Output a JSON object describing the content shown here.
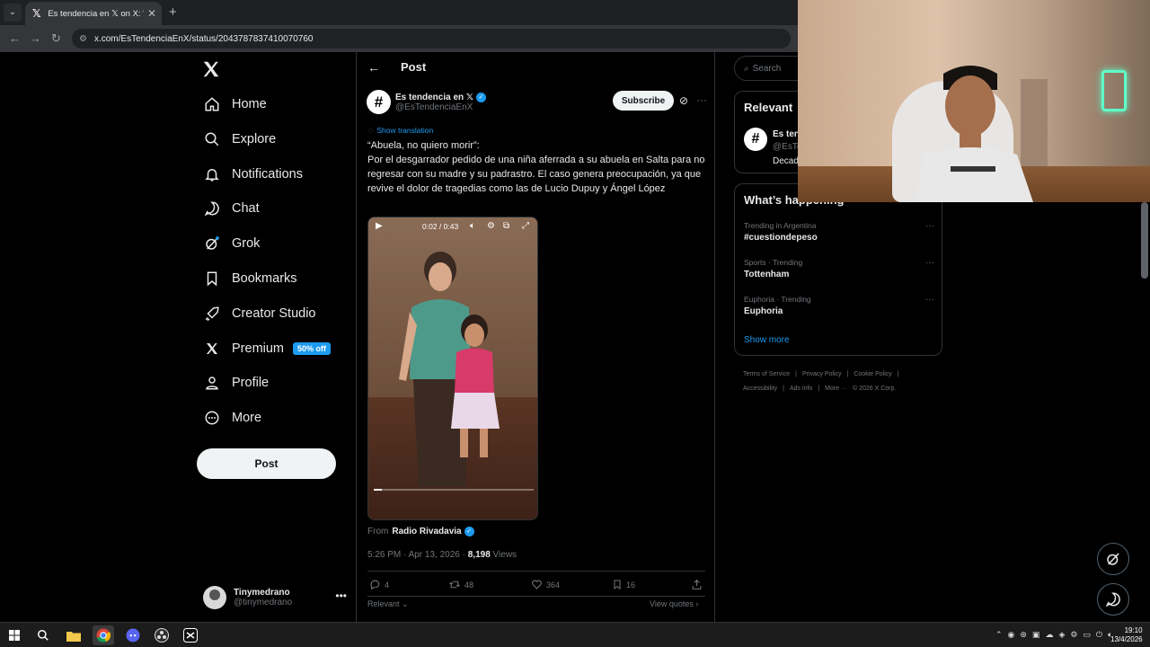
{
  "browser": {
    "tab_title": "Es tendencia en 𝕏 on X: \"\"Abuela",
    "url": "x.com/EsTendenciaEnX/status/2043787837410070760"
  },
  "nav": {
    "items": [
      {
        "label": "Home"
      },
      {
        "label": "Explore"
      },
      {
        "label": "Notifications"
      },
      {
        "label": "Chat"
      },
      {
        "label": "Grok"
      },
      {
        "label": "Bookmarks"
      },
      {
        "label": "Creator Studio"
      },
      {
        "label": "Premium",
        "badge": "50% off"
      },
      {
        "label": "Profile"
      },
      {
        "label": "More"
      }
    ],
    "post_button": "Post",
    "account": {
      "name": "Tinymedrano",
      "handle": "@tinymedrano"
    }
  },
  "main": {
    "header_title": "Post",
    "author": {
      "name": "Es tendencia en 𝕏",
      "handle": "@EsTendenciaEnX",
      "avatar_glyph": "#"
    },
    "subscribe": "Subscribe",
    "show_translation": "Show translation",
    "text_line1": "“Abuela, no quiero morir”:",
    "text_body": "Por el desgarrador pedido de una niña aferrada a su abuela en Salta para no regresar con su madre y su padrastro. El caso genera preocupación, ya que revive el dolor de tragedias como las de Lucio Dupuy y Ángel López",
    "video": {
      "time": "0:02 / 0:43",
      "progress": 0.05
    },
    "from_label": "From",
    "source": "Radio Rivadavia",
    "meta_time": "5:26 PM · Apr 13, 2026 · ",
    "views_count": "8,198",
    "views_label": " Views",
    "stats": {
      "replies": "4",
      "reposts": "48",
      "likes": "364",
      "bookmarks": "16"
    },
    "relevant_label": "Relevant",
    "view_quotes": "View quotes"
  },
  "right": {
    "search_placeholder": "Search",
    "relevant_header": "Relevant",
    "relevant_name": "Es ten",
    "relevant_handle": "@EsTe",
    "relevant_desc": "Decad",
    "happening_header": "What’s happening",
    "trends": [
      {
        "context": "Trending in Argentina",
        "name": "#cuestiondepeso"
      },
      {
        "context": "Sports · Trending",
        "name": "Tottenham"
      },
      {
        "context": "Euphoria · Trending",
        "name": "Euphoria"
      }
    ],
    "show_more": "Show more",
    "footer": [
      "Terms of Service",
      "|",
      "Privacy Policy",
      "|",
      "Cookie Policy",
      "|",
      "Accessibility",
      "|",
      "Ads info",
      "|",
      "More ···",
      "© 2026 X Corp."
    ]
  },
  "taskbar": {
    "time": "19:10",
    "date": "13/4/2026"
  }
}
